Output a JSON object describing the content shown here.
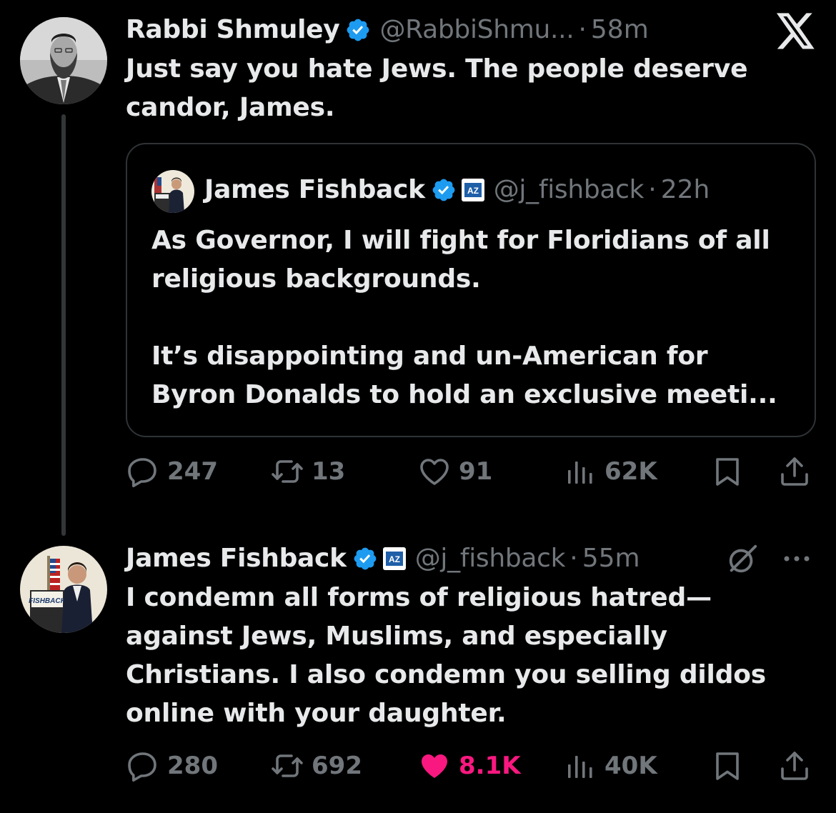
{
  "tweet1": {
    "author_name": "Rabbi Shmuley",
    "handle": "@RabbiShmu...",
    "separator": "·",
    "time": "58m",
    "text": "Just say you hate Jews. The people deserve\ncandor, James.",
    "quote": {
      "author_name": "James Fishback",
      "handle": "@j_fishback",
      "separator": "·",
      "time": "22h",
      "affiliate_badge_text": "AZ",
      "text": "As Governor, I will fight for Floridians of all\nreligious backgrounds.\n\nIt’s disappointing and un-American for\nByron Donalds to hold an exclusive meeti..."
    },
    "stats": {
      "replies": "247",
      "reposts": "13",
      "likes": "91",
      "views": "62K"
    }
  },
  "tweet2": {
    "author_name": "James Fishback",
    "handle": "@j_fishback",
    "separator": "·",
    "time": "55m",
    "affiliate_badge_text": "AZ",
    "avatar_sign_text": "FISHBACK",
    "text": "I condemn all forms of religious hatred—\nagainst Jews, Muslims, and especially\nChristians. I also condemn you selling dildos\nonline with your daughter.",
    "stats": {
      "replies": "280",
      "reposts": "692",
      "likes": "8.1K",
      "views": "40K"
    },
    "liked": true
  },
  "colors": {
    "background": "#000000",
    "text": "#e7e9ea",
    "secondary": "#71767b",
    "verified": "#1d9bf0",
    "like_active": "#f91880",
    "border": "#2f3336"
  },
  "icons": [
    "x-logo-icon",
    "verified-badge-icon",
    "affiliate-badge-icon",
    "reply-icon",
    "repost-icon",
    "like-icon",
    "views-icon",
    "bookmark-icon",
    "share-icon",
    "grok-icon",
    "more-icon"
  ]
}
